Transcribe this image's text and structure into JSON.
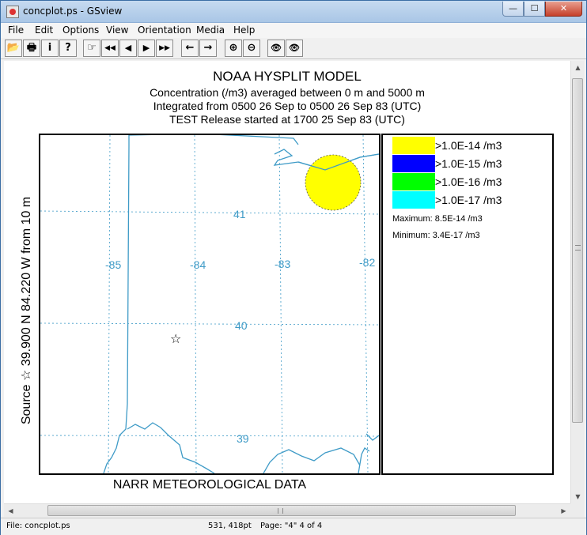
{
  "window": {
    "title": "concplot.ps - GSview",
    "controls": {
      "minimize": "—",
      "maximize": "☐",
      "close": "✕"
    }
  },
  "menu": [
    "File",
    "Edit",
    "Options",
    "View",
    "Orientation",
    "Media",
    "Help"
  ],
  "toolbar": {
    "buttons": [
      {
        "name": "open-icon",
        "glyph": "📂"
      },
      {
        "name": "print-icon",
        "glyph": "🖶"
      },
      {
        "name": "info-icon",
        "glyph": "i"
      },
      {
        "name": "help-icon",
        "glyph": "?"
      },
      {
        "name": "goto-page-icon",
        "glyph": "☞"
      },
      {
        "name": "first-page-icon",
        "glyph": "◀◀"
      },
      {
        "name": "prev-page-icon",
        "glyph": "◀"
      },
      {
        "name": "next-page-icon",
        "glyph": "▶"
      },
      {
        "name": "last-page-icon",
        "glyph": "▶▶"
      },
      {
        "name": "back-icon",
        "glyph": "←"
      },
      {
        "name": "forward-icon",
        "glyph": "→"
      },
      {
        "name": "zoom-in-icon",
        "glyph": "⊕"
      },
      {
        "name": "zoom-out-icon",
        "glyph": "⊖"
      },
      {
        "name": "find-icon",
        "glyph": "👁"
      },
      {
        "name": "find-next-icon",
        "glyph": "👁"
      }
    ]
  },
  "plot": {
    "title": "NOAA HYSPLIT MODEL",
    "line1": "Concentration  (/m3) averaged between      0 m and  5000 m",
    "line2": "Integrated from 0500 26 Sep to 0500 26 Sep 83 (UTC)",
    "line3": "TEST Release started at 1700 25 Sep 83 (UTC)",
    "source_label": "Source ☆  39.900  N  84.220  W    from    10 m",
    "bottom_label": "NARR METEOROLOGICAL DATA",
    "grid_labels": {
      "lon": [
        "-85",
        "-84",
        "-83",
        "-82"
      ],
      "lat": [
        "41",
        "40",
        "39"
      ]
    },
    "source_marker": "☆"
  },
  "legend": {
    "entries": [
      {
        "color": "#ffff00",
        "label": ">1.0E-14 /m3"
      },
      {
        "color": "#0000ff",
        "label": ">1.0E-15 /m3"
      },
      {
        "color": "#00ff00",
        "label": ">1.0E-16 /m3"
      },
      {
        "color": "#00ffff",
        "label": ">1.0E-17 /m3"
      }
    ],
    "maximum": "Maximum: 8.5E-14 /m3",
    "minimum": "Minimum: 3.4E-17 /m3"
  },
  "colors": {
    "map_lines": "#3f9bc7",
    "plume": "#ffff00"
  },
  "statusbar": {
    "file": "File: concplot.ps",
    "coords": "531, 418pt",
    "page": "Page: \"4\"  4 of 4"
  }
}
